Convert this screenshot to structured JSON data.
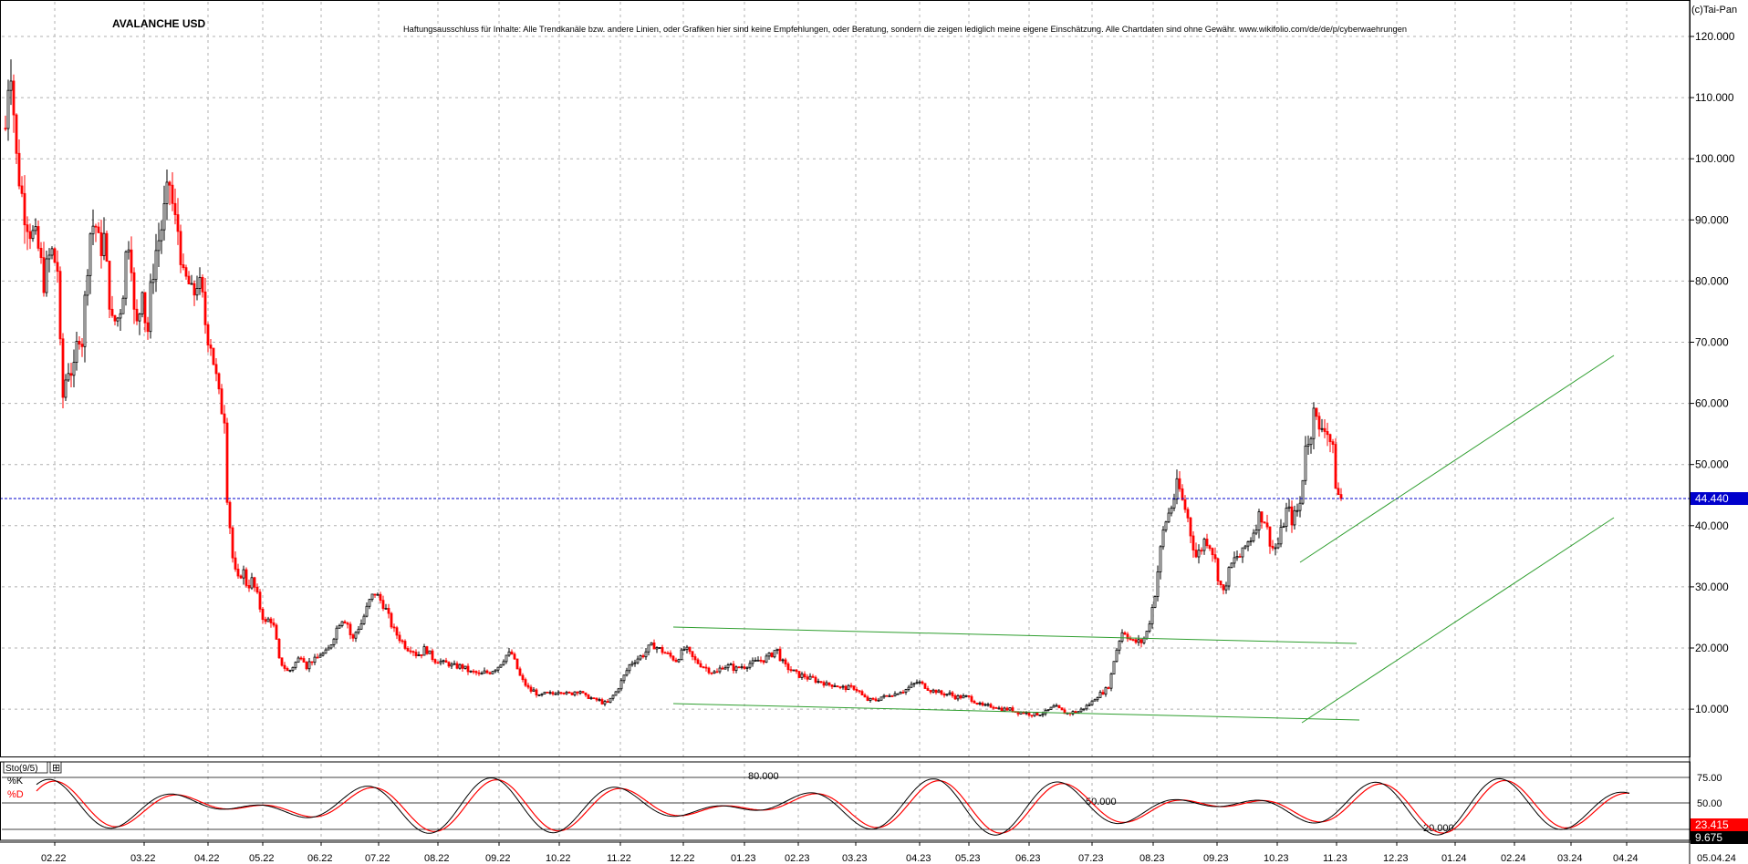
{
  "header": {
    "title": "AVALANCHE USD",
    "disclaimer": "Haftungsausschluss für Inhalte: Alle Trendkanäle bzw. andere Linien, oder Grafiken hier sind keine Empfehlungen, oder Beratung, sondern die zeigen lediglich meine eigene Einschätzung. Alle Chartdaten sind ohne Gewähr.  www.wikifolio.com/de/de/p/cyberwaehrungen",
    "copyright": "(c)Tai-Pan"
  },
  "colors": {
    "up": "#000000",
    "down": "#ff0000",
    "channel": "#2e9e2e",
    "current_line": "#0000cc",
    "grid": "#b0b0b0"
  },
  "chart_data": [
    {
      "type": "candlestick",
      "title": "AVALANCHE USD",
      "y_ticks": [
        10,
        20,
        30,
        40,
        50,
        60,
        70,
        80,
        90,
        100,
        110,
        120
      ],
      "y_tick_labels": [
        "10.000",
        "20.000",
        "30.000",
        "40.000",
        "50.000",
        "60.000",
        "70.000",
        "80.000",
        "90.000",
        "100.000",
        "110.000",
        "120.000"
      ],
      "ylim": [
        2,
        125
      ],
      "x_labels": [
        "02.22",
        "03.22",
        "04.22",
        "05.22",
        "06.22",
        "07.22",
        "08.22",
        "09.22",
        "10.22",
        "11.22",
        "12.22",
        "01.23",
        "02.23",
        "03.23",
        "04.23",
        "05.23",
        "06.23",
        "07.23",
        "08.23",
        "09.23",
        "10.23",
        "11.23",
        "12.23",
        "01.24",
        "02.24",
        "03.24",
        "04.24"
      ],
      "x_end_label": "05.04.24",
      "current_price": 44.44,
      "current_price_label": "44.440",
      "anchor_series": [
        [
          0,
          105
        ],
        [
          5,
          118
        ],
        [
          12,
          100
        ],
        [
          20,
          92
        ],
        [
          28,
          88
        ],
        [
          35,
          86
        ],
        [
          42,
          80
        ],
        [
          50,
          85
        ],
        [
          57,
          82
        ],
        [
          62,
          60
        ],
        [
          68,
          66
        ],
        [
          75,
          65
        ],
        [
          80,
          72
        ],
        [
          85,
          70
        ],
        [
          88,
          80
        ],
        [
          93,
          88
        ],
        [
          98,
          90
        ],
        [
          103,
          85
        ],
        [
          108,
          87
        ],
        [
          112,
          80
        ],
        [
          117,
          73
        ],
        [
          123,
          74
        ],
        [
          128,
          77
        ],
        [
          133,
          86
        ],
        [
          137,
          88
        ],
        [
          140,
          75
        ],
        [
          145,
          72
        ],
        [
          150,
          80
        ],
        [
          155,
          70
        ],
        [
          160,
          80
        ],
        [
          165,
          85
        ],
        [
          170,
          88
        ],
        [
          175,
          92
        ],
        [
          180,
          96
        ],
        [
          185,
          90
        ],
        [
          190,
          88
        ],
        [
          195,
          80
        ],
        [
          200,
          80
        ],
        [
          205,
          77
        ],
        [
          210,
          80
        ],
        [
          215,
          78
        ],
        [
          220,
          72
        ],
        [
          225,
          70
        ],
        [
          230,
          65
        ],
        [
          235,
          60
        ],
        [
          240,
          58
        ],
        [
          243,
          45
        ],
        [
          246,
          40
        ],
        [
          250,
          33
        ],
        [
          255,
          31
        ],
        [
          260,
          33
        ],
        [
          265,
          30
        ],
        [
          270,
          31
        ],
        [
          275,
          29
        ],
        [
          280,
          26
        ],
        [
          285,
          24
        ],
        [
          290,
          25
        ],
        [
          295,
          23
        ],
        [
          300,
          18
        ],
        [
          305,
          17
        ],
        [
          310,
          16
        ],
        [
          315,
          17
        ],
        [
          320,
          18
        ],
        [
          325,
          19
        ],
        [
          330,
          17
        ],
        [
          335,
          18
        ],
        [
          340,
          18
        ],
        [
          345,
          19
        ],
        [
          350,
          19
        ],
        [
          355,
          20
        ],
        [
          360,
          22
        ],
        [
          365,
          24
        ],
        [
          370,
          25
        ],
        [
          375,
          24
        ],
        [
          380,
          21
        ],
        [
          385,
          23
        ],
        [
          390,
          24
        ],
        [
          395,
          26
        ],
        [
          400,
          28
        ],
        [
          405,
          29
        ],
        [
          410,
          28
        ],
        [
          415,
          27
        ],
        [
          420,
          25
        ],
        [
          425,
          23
        ],
        [
          430,
          22
        ],
        [
          435,
          21
        ],
        [
          440,
          20
        ],
        [
          445,
          20
        ],
        [
          450,
          19
        ],
        [
          455,
          19
        ],
        [
          460,
          20
        ],
        [
          465,
          19
        ],
        [
          470,
          18
        ],
        [
          475,
          18
        ],
        [
          480,
          17.5
        ],
        [
          485,
          17.5
        ],
        [
          490,
          17
        ],
        [
          495,
          17
        ],
        [
          500,
          17
        ],
        [
          505,
          16.5
        ],
        [
          510,
          16
        ],
        [
          515,
          16
        ],
        [
          520,
          15.5
        ],
        [
          525,
          16
        ],
        [
          530,
          16
        ],
        [
          535,
          16.5
        ],
        [
          540,
          17
        ],
        [
          545,
          18
        ],
        [
          550,
          19
        ],
        [
          555,
          19
        ],
        [
          560,
          17
        ],
        [
          565,
          15
        ],
        [
          570,
          14
        ],
        [
          575,
          13
        ],
        [
          580,
          13
        ],
        [
          585,
          12
        ],
        [
          590,
          12.5
        ],
        [
          595,
          12.5
        ],
        [
          600,
          12.5
        ],
        [
          605,
          13
        ],
        [
          610,
          13
        ],
        [
          615,
          12.5
        ],
        [
          620,
          12.5
        ],
        [
          625,
          13
        ],
        [
          630,
          13
        ],
        [
          635,
          12
        ],
        [
          640,
          12
        ],
        [
          645,
          11.5
        ],
        [
          650,
          11.5
        ],
        [
          655,
          11
        ],
        [
          660,
          11
        ],
        [
          665,
          12
        ],
        [
          670,
          13
        ],
        [
          675,
          14.5
        ],
        [
          680,
          16
        ],
        [
          685,
          17.5
        ],
        [
          690,
          18
        ],
        [
          695,
          18.5
        ],
        [
          700,
          19
        ],
        [
          705,
          20
        ],
        [
          710,
          20.5
        ],
        [
          715,
          20
        ],
        [
          720,
          19.5
        ],
        [
          725,
          19
        ],
        [
          730,
          18.5
        ],
        [
          735,
          18
        ],
        [
          740,
          19
        ],
        [
          745,
          20
        ],
        [
          750,
          19
        ],
        [
          755,
          18
        ],
        [
          760,
          17.5
        ],
        [
          765,
          17
        ],
        [
          770,
          16.5
        ],
        [
          775,
          16
        ],
        [
          780,
          16
        ],
        [
          785,
          17
        ],
        [
          790,
          17
        ],
        [
          795,
          17
        ],
        [
          800,
          16.5
        ],
        [
          805,
          17
        ],
        [
          810,
          17
        ],
        [
          815,
          17.5
        ],
        [
          820,
          17.5
        ],
        [
          825,
          18
        ],
        [
          830,
          18
        ],
        [
          835,
          18.5
        ],
        [
          840,
          19
        ],
        [
          845,
          20
        ],
        [
          850,
          18
        ],
        [
          855,
          17
        ],
        [
          860,
          16.5
        ],
        [
          865,
          16
        ],
        [
          870,
          15.5
        ],
        [
          875,
          15.5
        ],
        [
          880,
          15
        ],
        [
          885,
          15
        ],
        [
          890,
          14.5
        ],
        [
          895,
          14.5
        ],
        [
          900,
          14
        ],
        [
          905,
          14
        ],
        [
          910,
          14
        ],
        [
          915,
          13.5
        ],
        [
          920,
          13.5
        ],
        [
          925,
          13.5
        ],
        [
          930,
          13.5
        ],
        [
          935,
          13
        ],
        [
          940,
          12
        ],
        [
          945,
          11.5
        ],
        [
          950,
          11.5
        ],
        [
          955,
          11.5
        ],
        [
          960,
          12
        ],
        [
          965,
          12
        ],
        [
          970,
          12.5
        ],
        [
          975,
          12.5
        ],
        [
          980,
          13
        ],
        [
          985,
          13
        ],
        [
          990,
          13.5
        ],
        [
          995,
          14
        ],
        [
          1000,
          14.5
        ],
        [
          1005,
          14
        ],
        [
          1010,
          13.5
        ],
        [
          1015,
          13
        ],
        [
          1020,
          13
        ],
        [
          1025,
          12.5
        ],
        [
          1030,
          12.5
        ],
        [
          1035,
          12.5
        ],
        [
          1040,
          12
        ],
        [
          1045,
          12
        ],
        [
          1050,
          12
        ],
        [
          1055,
          12
        ],
        [
          1060,
          11.5
        ],
        [
          1065,
          11
        ],
        [
          1070,
          10.5
        ],
        [
          1075,
          10.5
        ],
        [
          1080,
          10.5
        ],
        [
          1085,
          10.5
        ],
        [
          1090,
          10
        ],
        [
          1095,
          10
        ],
        [
          1100,
          10
        ],
        [
          1105,
          9.8
        ],
        [
          1110,
          9.5
        ],
        [
          1115,
          9.5
        ],
        [
          1120,
          9.3
        ],
        [
          1125,
          9.2
        ],
        [
          1130,
          9.2
        ],
        [
          1135,
          9.3
        ],
        [
          1140,
          9.5
        ],
        [
          1145,
          10
        ],
        [
          1150,
          10.5
        ],
        [
          1155,
          10
        ],
        [
          1160,
          9.5
        ],
        [
          1165,
          9.3
        ],
        [
          1170,
          9.5
        ],
        [
          1175,
          9.5
        ],
        [
          1180,
          10
        ],
        [
          1185,
          10.5
        ],
        [
          1190,
          11
        ],
        [
          1195,
          12
        ],
        [
          1200,
          12.5
        ],
        [
          1205,
          13
        ],
        [
          1210,
          14
        ],
        [
          1215,
          18
        ],
        [
          1220,
          21
        ],
        [
          1225,
          23
        ],
        [
          1230,
          22
        ],
        [
          1235,
          21
        ],
        [
          1240,
          21
        ],
        [
          1245,
          21
        ],
        [
          1250,
          22
        ],
        [
          1255,
          25
        ],
        [
          1260,
          29
        ],
        [
          1265,
          35
        ],
        [
          1270,
          40
        ],
        [
          1275,
          42
        ],
        [
          1280,
          44
        ],
        [
          1285,
          47
        ],
        [
          1290,
          44
        ],
        [
          1295,
          42
        ],
        [
          1300,
          38
        ],
        [
          1305,
          35
        ],
        [
          1310,
          36
        ],
        [
          1315,
          38
        ],
        [
          1320,
          37
        ],
        [
          1325,
          35
        ],
        [
          1330,
          31
        ],
        [
          1335,
          29
        ],
        [
          1340,
          32
        ],
        [
          1345,
          34
        ],
        [
          1350,
          35
        ],
        [
          1355,
          35
        ],
        [
          1360,
          37
        ],
        [
          1365,
          38
        ],
        [
          1370,
          40
        ],
        [
          1375,
          42
        ],
        [
          1380,
          41
        ],
        [
          1385,
          38
        ],
        [
          1390,
          36
        ],
        [
          1395,
          37
        ],
        [
          1400,
          40
        ],
        [
          1405,
          43
        ],
        [
          1410,
          41
        ],
        [
          1415,
          42
        ],
        [
          1420,
          44
        ],
        [
          1425,
          54
        ],
        [
          1430,
          52
        ],
        [
          1433,
          62
        ],
        [
          1437,
          57
        ],
        [
          1440,
          55
        ],
        [
          1445,
          57
        ],
        [
          1450,
          55
        ],
        [
          1455,
          52
        ],
        [
          1458,
          47
        ],
        [
          1461,
          45
        ],
        [
          1464,
          44.44
        ]
      ]
    },
    {
      "type": "line",
      "title": "Sto(9/5)",
      "series": [
        {
          "name": "%K"
        },
        {
          "name": "%D"
        }
      ],
      "levels": [
        80,
        50,
        20
      ],
      "level_labels": [
        "80.000",
        "50.000",
        "20.000"
      ],
      "axis_labels": [
        "75.00",
        "50.00"
      ],
      "last_values": [
        "23.415",
        "9.675"
      ],
      "ylim": [
        0,
        100
      ]
    }
  ]
}
